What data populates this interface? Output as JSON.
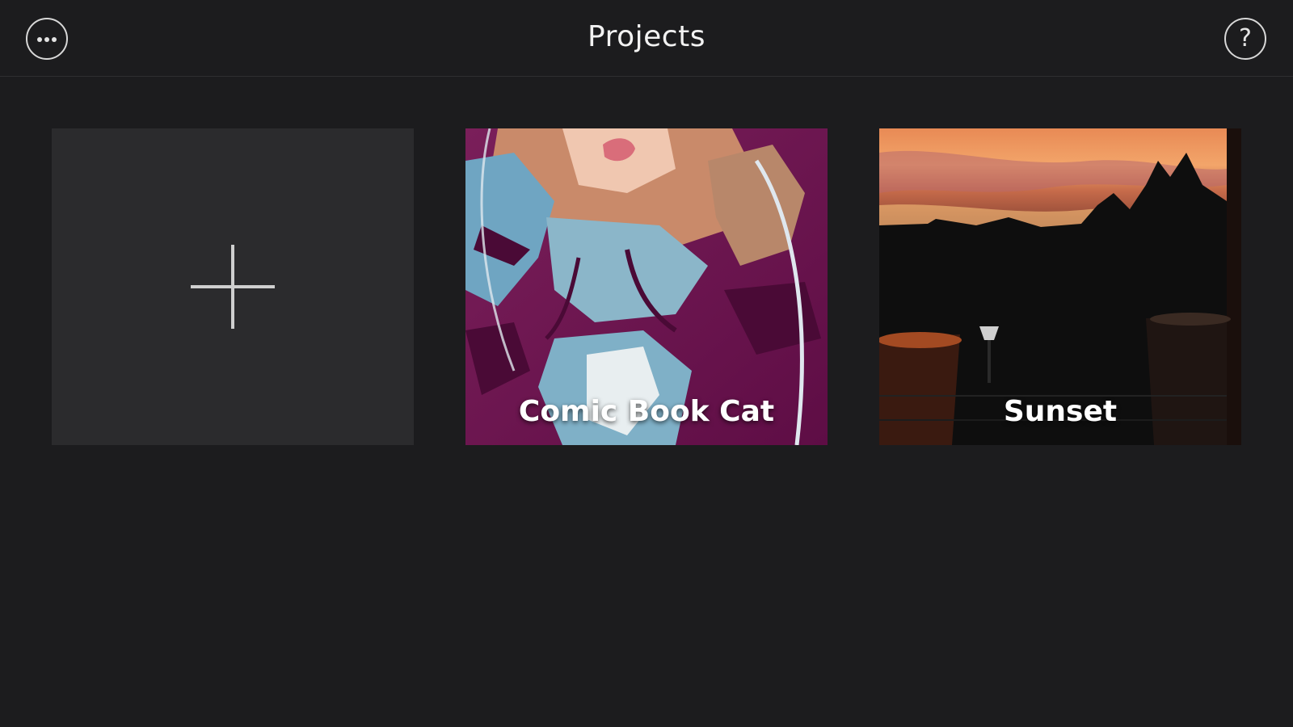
{
  "header": {
    "title": "Projects",
    "menu_icon": "more-ellipsis-icon",
    "help_icon": "question-mark-icon",
    "help_glyph": "?"
  },
  "projects": [
    {
      "type": "new",
      "icon": "plus-icon"
    },
    {
      "type": "project",
      "label": "Comic Book Cat"
    },
    {
      "type": "project",
      "label": "Sunset"
    }
  ],
  "colors": {
    "background": "#1c1c1e",
    "new_tile": "#2b2b2d",
    "text": "#f2f2f2"
  }
}
